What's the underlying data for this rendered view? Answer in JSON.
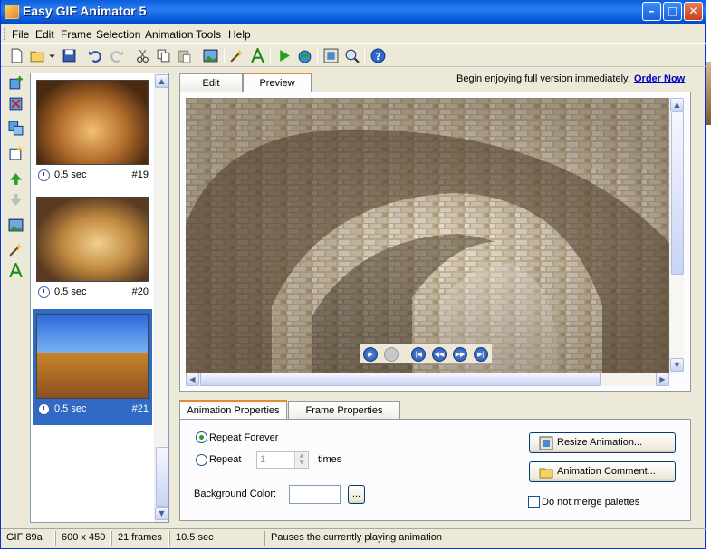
{
  "window": {
    "title": "Easy GIF Animator 5"
  },
  "menu": [
    "File",
    "Edit",
    "Frame",
    "Selection",
    "Animation",
    "Tools",
    "Help"
  ],
  "toolbar_icons": [
    "new-icon",
    "open-icon",
    "open-dropdown-icon",
    "save-icon",
    "undo-icon",
    "redo-icon",
    "cut-icon",
    "copy-icon",
    "paste-icon",
    "image-effects-icon",
    "wizard-icon",
    "text-icon",
    "play-icon",
    "export-icon",
    "resize-icon",
    "zoom-icon",
    "help-icon"
  ],
  "left_tools": [
    "insert-frame-icon",
    "delete-frame-icon",
    "duplicate-frame-icon",
    "insert-blank-icon",
    "move-up-icon",
    "move-down-icon",
    "image-effects-icon",
    "wizard-icon",
    "text-icon"
  ],
  "frames": [
    {
      "duration": "0.5 sec",
      "number": "#19",
      "selected": false
    },
    {
      "duration": "0.5 sec",
      "number": "#20",
      "selected": false
    },
    {
      "duration": "0.5 sec",
      "number": "#21",
      "selected": true
    }
  ],
  "tabs": {
    "edit": "Edit",
    "preview": "Preview",
    "active": "Preview"
  },
  "promo": {
    "text": "Begin enjoying full version immediately.",
    "link": "Order Now"
  },
  "player_controls": [
    "play-icon",
    "stop-icon",
    "first-frame-icon",
    "previous-frame-icon",
    "next-frame-icon",
    "last-frame-icon"
  ],
  "property_tabs": {
    "animation": "Animation Properties",
    "frame": "Frame Properties",
    "active": "Animation Properties"
  },
  "properties": {
    "repeat_forever": "Repeat Forever",
    "repeat": "Repeat",
    "repeat_count": "1",
    "times": "times",
    "background_color": "Background Color:",
    "browse": "...",
    "resize_button": "Resize Animation...",
    "comment_button": "Animation Comment...",
    "merge_palettes": "Do not merge palettes",
    "repeat_forever_checked": true,
    "merge_palettes_checked": false
  },
  "status": {
    "format": "GIF 89a",
    "size": "600 x 450",
    "frames": "21 frames",
    "length": "10.5 sec",
    "message": "Pauses the currently playing animation"
  },
  "colors": {
    "titlebar": "#0a5fdc",
    "selection": "#316ac5",
    "link": "#0000c0",
    "face": "#ece9d8"
  }
}
